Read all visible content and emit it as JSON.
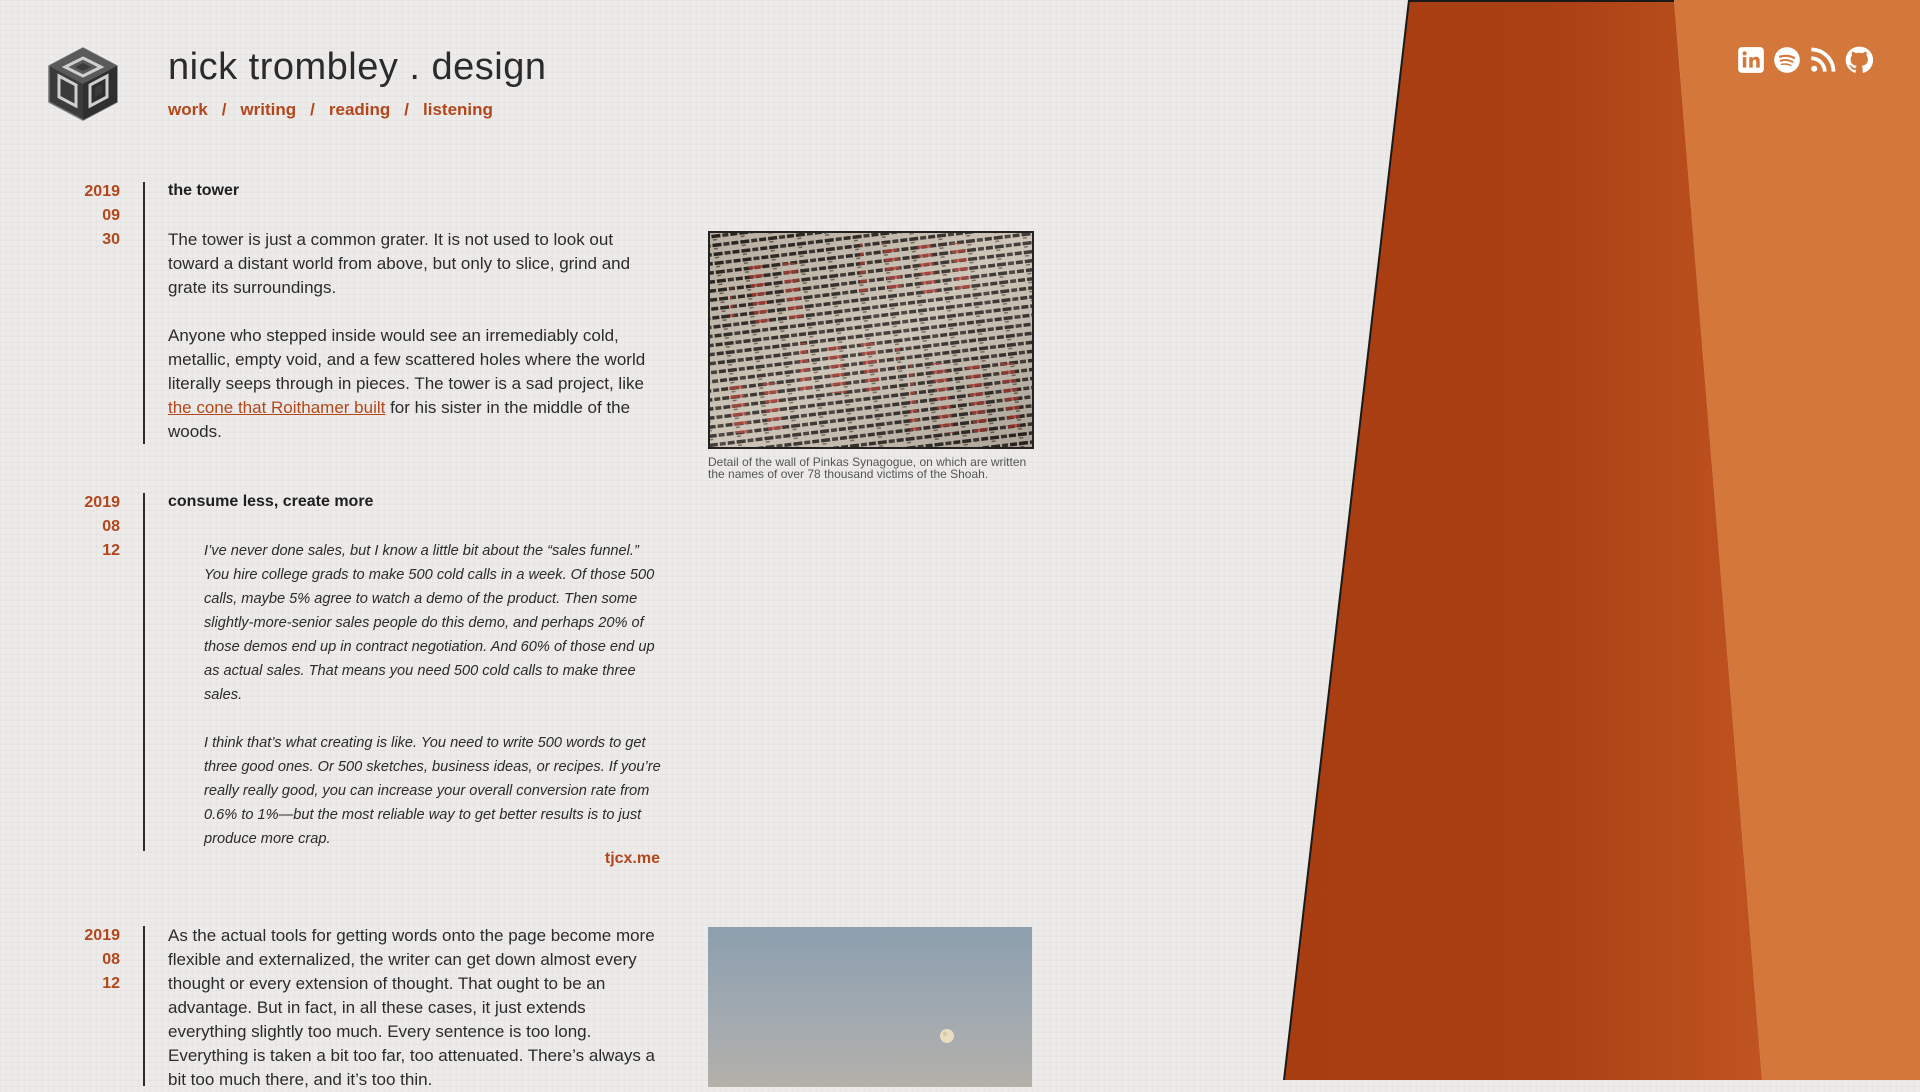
{
  "site": {
    "title": "nick trombley . design",
    "nav": [
      {
        "label": "work"
      },
      {
        "label": "writing"
      },
      {
        "label": "reading"
      },
      {
        "label": "listening"
      }
    ],
    "nav_separator": "/",
    "social_icons": [
      "linkedin-icon",
      "spotify-icon",
      "rss-icon",
      "github-icon"
    ]
  },
  "colors": {
    "accent": "#b3461b",
    "panel_dark": "#a83d12",
    "panel_light": "#d4773a",
    "background": "#ecebe9",
    "text": "#2b2b2b"
  },
  "posts": [
    {
      "year": "2019",
      "month": "09",
      "day": "30",
      "title": "the tower",
      "p1": "The tower is just a common grater. It is not used to look out toward a distant world from above, but only to slice, grind and grate its surroundings.",
      "p2_before": "Anyone who stepped inside would see an irremediably cold, metallic, empty void, and a few scattered holes where the world literally seeps through in pieces. The tower is a sad project, like ",
      "p2_link": "the cone that Roithamer built",
      "p2_after": " for his sister in the middle of the woods.",
      "caption": "Detail of the wall of Pinkas Synagogue, on which are written the names of over 78 thousand victims of the Shoah."
    },
    {
      "year": "2019",
      "month": "08",
      "day": "12",
      "title": "consume less, create more",
      "quote1": "I’ve never done sales, but I know a little bit about the “sales funnel.” You hire college grads to make 500 cold calls in a week. Of those 500 calls, maybe 5% agree to watch a demo of the product. Then some slightly-more-senior sales people do this demo, and perhaps 20% of those demos end up in contract negotiation. And 60% of those end up as actual sales. That means you need 500 cold calls to make three sales.",
      "quote2": "I think that’s what creating is like. You need to write 500 words to get three good ones. Or 500 sketches, business ideas, or recipes. If you’re really really good, you can increase your overall conversion rate from 0.6% to 1%—but the most reliable way to get better results is to just produce more crap.",
      "source": "tjcx.me"
    },
    {
      "year": "2019",
      "month": "08",
      "day": "12",
      "p1": "As the actual tools for getting words onto the page become more flexible and externalized, the writer can get down almost every thought or every extension of thought. That ought to be an advantage. But in fact, in all these cases, it just extends everything slightly too much. Every sentence is too long. Everything is taken a bit too far, too attenuated. There’s always a bit too much there, and it’s too thin."
    }
  ]
}
